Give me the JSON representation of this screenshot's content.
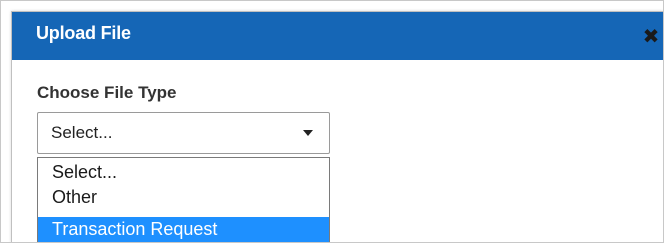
{
  "dialog": {
    "title": "Upload File",
    "close_icon": "close-icon",
    "close_glyph": "✖",
    "accent_color": "#1566b6"
  },
  "form": {
    "file_type_label": "Choose File Type",
    "select_value": "Select...",
    "options": [
      {
        "label": "Select...",
        "highlighted": false
      },
      {
        "label": "Other",
        "highlighted": false
      },
      {
        "label": "Transaction Request",
        "highlighted": true
      }
    ],
    "highlight_color": "#1e90ff"
  }
}
